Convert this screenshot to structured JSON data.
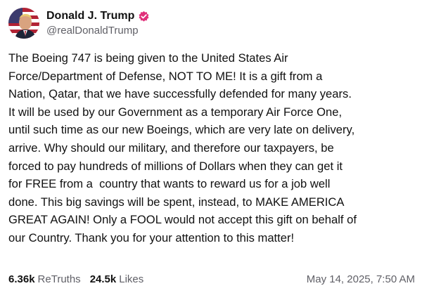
{
  "author": {
    "display_name": "Donald J. Trump",
    "handle": "@realDonaldTrump",
    "verified": true,
    "avatar_icon": "profile-avatar-flag",
    "verified_icon": "verified-check-icon",
    "verified_color": "#e0307a"
  },
  "post": {
    "text": "The Boeing 747 is being given to the United States Air\nForce/Department of Defense, NOT TO ME! It is a gift from a\nNation, Qatar, that we have successfully defended for many years.\nIt will be used by our Government as a temporary Air Force One,\nuntil such time as our new Boeings, which are very late on delivery,\narrive. Why should our military, and therefore our taxpayers, be\nforced to pay hundreds of millions of Dollars when they can get it\nfor FREE from a  country that wants to reward us for a job well\ndone. This big savings will be spent, instead, to MAKE AMERICA\nGREAT AGAIN! Only a FOOL would not accept this gift on behalf of\nour Country. Thank you for your attention to this matter!"
  },
  "stats": {
    "retruths_count": "6.36k",
    "retruths_label": "ReTruths",
    "likes_count": "24.5k",
    "likes_label": "Likes"
  },
  "timestamp": "May 14, 2025, 7:50 AM"
}
